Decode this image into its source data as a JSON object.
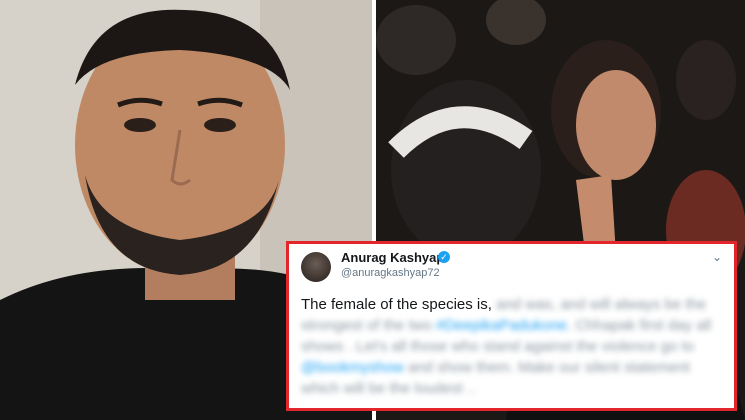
{
  "tweet": {
    "name": "Anurag Kashyap",
    "handle": "@anuragkashyap72",
    "text_visible": "The female of the species is,",
    "text_blurred_1": "and was, and will always be the strongest of the two",
    "hashtag": "#DeepikaPadukone",
    "text_blurred_2": ". Chhapak first day all shows . Let's all those who stand against the violence go to",
    "mention": "@bookmyshow",
    "text_blurred_3": "and show them. Make our silent statement which will be the loudest .."
  },
  "colors": {
    "border": "#e3262c",
    "verified": "#1da1f2"
  }
}
